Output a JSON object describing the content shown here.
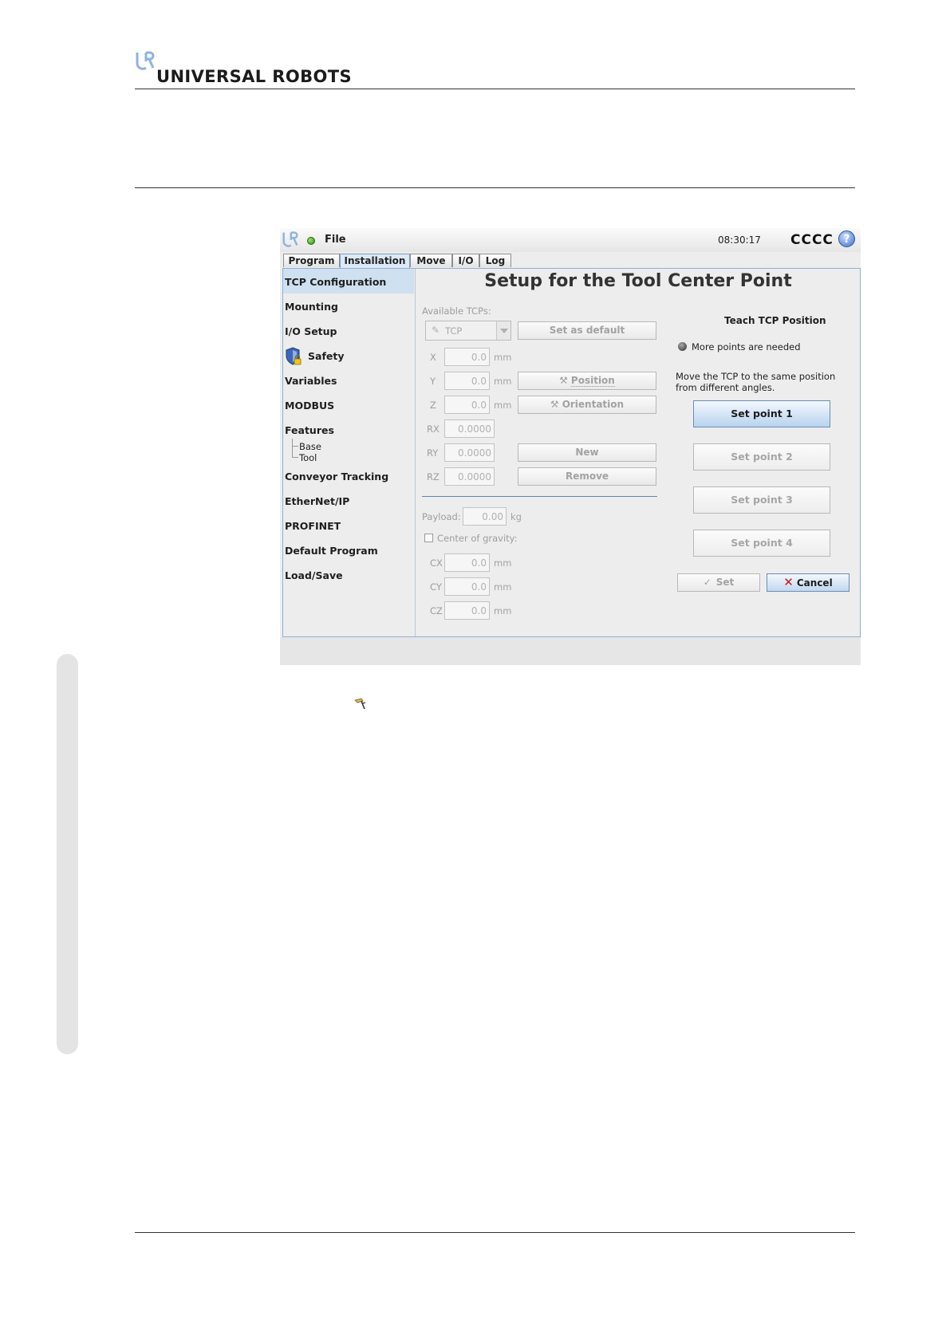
{
  "document": {
    "brand": "UNIVERSAL ROBOTS",
    "logo_icon": "ur-logo-icon",
    "inline_icon": "tcp-tool-icon"
  },
  "ui": {
    "menu": {
      "file": "File"
    },
    "clock": "08:30:17",
    "robot_name": "CCCC",
    "help": "?",
    "tabs": [
      {
        "label": "Program",
        "active": false
      },
      {
        "label": "Installation",
        "active": true
      },
      {
        "label": "Move",
        "active": false
      },
      {
        "label": "I/O",
        "active": false
      },
      {
        "label": "Log",
        "active": false
      }
    ],
    "nav": {
      "items": [
        {
          "label": "TCP Configuration",
          "selected": true
        },
        {
          "label": "Mounting"
        },
        {
          "label": "I/O Setup"
        },
        {
          "label": "Safety",
          "icon": "safety-shield-lock-icon"
        },
        {
          "label": "Variables"
        },
        {
          "label": "MODBUS"
        },
        {
          "label": "Features"
        },
        {
          "label": "Conveyor Tracking"
        },
        {
          "label": "EtherNet/IP"
        },
        {
          "label": "PROFINET"
        },
        {
          "label": "Default Program"
        },
        {
          "label": "Load/Save"
        }
      ],
      "features_children": [
        "Base",
        "Tool"
      ]
    },
    "title": "Setup for the Tool Center Point",
    "available_tcps_label": "Available TCPs:",
    "tcp_selected": "TCP",
    "set_default": "Set as default",
    "position_button": "Position",
    "orientation_button": "Orientation",
    "new_button": "New",
    "remove_button": "Remove",
    "coords": [
      {
        "label": "X",
        "value": "0.0",
        "unit": "mm"
      },
      {
        "label": "Y",
        "value": "0.0",
        "unit": "mm"
      },
      {
        "label": "Z",
        "value": "0.0",
        "unit": "mm"
      },
      {
        "label": "RX",
        "value": "0.0000",
        "unit": ""
      },
      {
        "label": "RY",
        "value": "0.0000",
        "unit": ""
      },
      {
        "label": "RZ",
        "value": "0.0000",
        "unit": ""
      }
    ],
    "payload": {
      "label": "Payload:",
      "value": "0.00",
      "unit": "kg"
    },
    "cog": {
      "label": "Center of gravity:",
      "checked": false,
      "fields": [
        {
          "label": "CX",
          "value": "0.0",
          "unit": "mm"
        },
        {
          "label": "CY",
          "value": "0.0",
          "unit": "mm"
        },
        {
          "label": "CZ",
          "value": "0.0",
          "unit": "mm"
        }
      ]
    },
    "teach": {
      "title": "Teach TCP Position",
      "status": "More points are needed",
      "instruction_line1": "Move the TCP to the same position",
      "instruction_line2": "from different angles.",
      "points": [
        "Set point 1",
        "Set point 2",
        "Set point 3",
        "Set point 4"
      ]
    },
    "set_button": "Set",
    "cancel_button": "Cancel",
    "colors": {
      "accent": "#6d8db3",
      "selection": "#cfe0f0",
      "status_ok": "#2d8a12",
      "cancel": "#c8161d"
    }
  }
}
